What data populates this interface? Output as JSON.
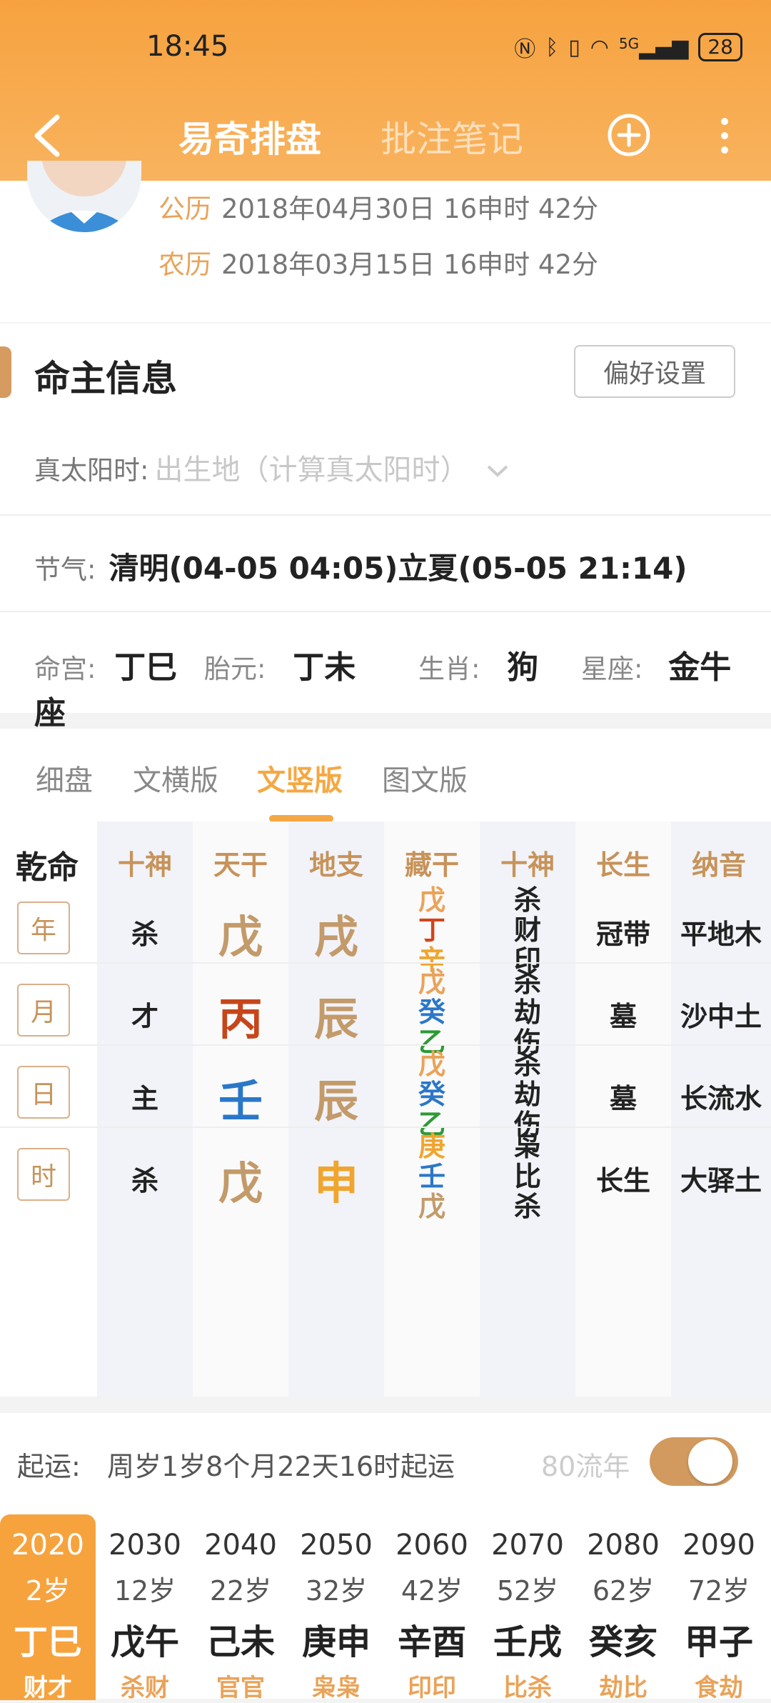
{
  "status_bar": {
    "time": "18:45",
    "battery": "28",
    "signal_label": "5G"
  },
  "nav": {
    "title": "易奇排盘",
    "notes_tab": "批注笔记"
  },
  "birth": {
    "solar_label": "公历",
    "solar_value": "2018年04月30日 16申时 42分",
    "lunar_label": "农历",
    "lunar_value": "2018年03月15日 16申时 42分"
  },
  "master_info": {
    "title": "命主信息",
    "pref_button": "偏好设置",
    "solar_time_label": "真太阳时:",
    "solar_time_placeholder": "出生地（计算真太阳时）",
    "jieqi_label": "节气:",
    "jieqi_value": "清明(04-05 04:05)立夏(05-05 21:14)",
    "minggong_label": "命宫:",
    "minggong_value": "丁巳",
    "taiyuan_label": "胎元:",
    "taiyuan_value": "丁未",
    "shengxiao_label": "生肖:",
    "shengxiao_value": "狗",
    "xingzuo_label": "星座:",
    "xingzuo_value": "金牛座"
  },
  "tabs": [
    "细盘",
    "文横版",
    "文竖版",
    "图文版"
  ],
  "active_tab": "文竖版",
  "table": {
    "corner": "乾命",
    "headers": [
      "十神",
      "天干",
      "地支",
      "藏干",
      "十神",
      "长生",
      "纳音"
    ],
    "rows": [
      {
        "pillar": "年",
        "shishen": "杀",
        "gan": "戊",
        "gan_color": "#c39a6a",
        "zhi": "戌",
        "zhi_color": "#c39a6a",
        "canggan": [
          {
            "c": "戊",
            "color": "#e9a35a"
          },
          {
            "c": "丁",
            "color": "#d2451b"
          },
          {
            "c": "辛",
            "color": "#f0a52e"
          }
        ],
        "ten": [
          "杀",
          "财",
          "印"
        ],
        "changsheng": "冠带",
        "nayin": "平地木"
      },
      {
        "pillar": "月",
        "shishen": "才",
        "gan": "丙",
        "gan_color": "#c5461b",
        "zhi": "辰",
        "zhi_color": "#c39a6a",
        "canggan": [
          {
            "c": "戊",
            "color": "#e9a35a"
          },
          {
            "c": "癸",
            "color": "#2a77c9"
          },
          {
            "c": "乙",
            "color": "#2e9a36"
          }
        ],
        "ten": [
          "杀",
          "劫",
          "伤"
        ],
        "changsheng": "墓",
        "nayin": "沙中土"
      },
      {
        "pillar": "日",
        "shishen": "主",
        "gan": "壬",
        "gan_color": "#2a77c9",
        "zhi": "辰",
        "zhi_color": "#c39a6a",
        "canggan": [
          {
            "c": "戊",
            "color": "#e9a35a"
          },
          {
            "c": "癸",
            "color": "#2a77c9"
          },
          {
            "c": "乙",
            "color": "#2e9a36"
          }
        ],
        "ten": [
          "杀",
          "劫",
          "伤"
        ],
        "changsheng": "墓",
        "nayin": "长流水"
      },
      {
        "pillar": "时",
        "shishen": "杀",
        "gan": "戊",
        "gan_color": "#c39a6a",
        "zhi": "申",
        "zhi_color": "#f0a52e",
        "canggan": [
          {
            "c": "庚",
            "color": "#f0a52e"
          },
          {
            "c": "壬",
            "color": "#2a77c9"
          },
          {
            "c": "戊",
            "color": "#c39a6a"
          }
        ],
        "ten": [
          "枭",
          "比",
          "杀"
        ],
        "changsheng": "长生",
        "nayin": "大驿土"
      }
    ]
  },
  "luck": {
    "label": "起运:",
    "text": "周岁1岁8个月22天16时起运",
    "flow_label": "80流年",
    "columns": [
      {
        "year": "2020",
        "age": "2岁",
        "gz": "丁巳",
        "ss": "财才"
      },
      {
        "year": "2030",
        "age": "12岁",
        "gz": "戊午",
        "ss": "杀财"
      },
      {
        "year": "2040",
        "age": "22岁",
        "gz": "己未",
        "ss": "官官"
      },
      {
        "year": "2050",
        "age": "32岁",
        "gz": "庚申",
        "ss": "枭枭"
      },
      {
        "year": "2060",
        "age": "42岁",
        "gz": "辛酉",
        "ss": "印印"
      },
      {
        "year": "2070",
        "age": "52岁",
        "gz": "壬戌",
        "ss": "比杀"
      },
      {
        "year": "2080",
        "age": "62岁",
        "gz": "癸亥",
        "ss": "劫比"
      },
      {
        "year": "2090",
        "age": "72岁",
        "gz": "甲子",
        "ss": "食劫"
      }
    ]
  }
}
